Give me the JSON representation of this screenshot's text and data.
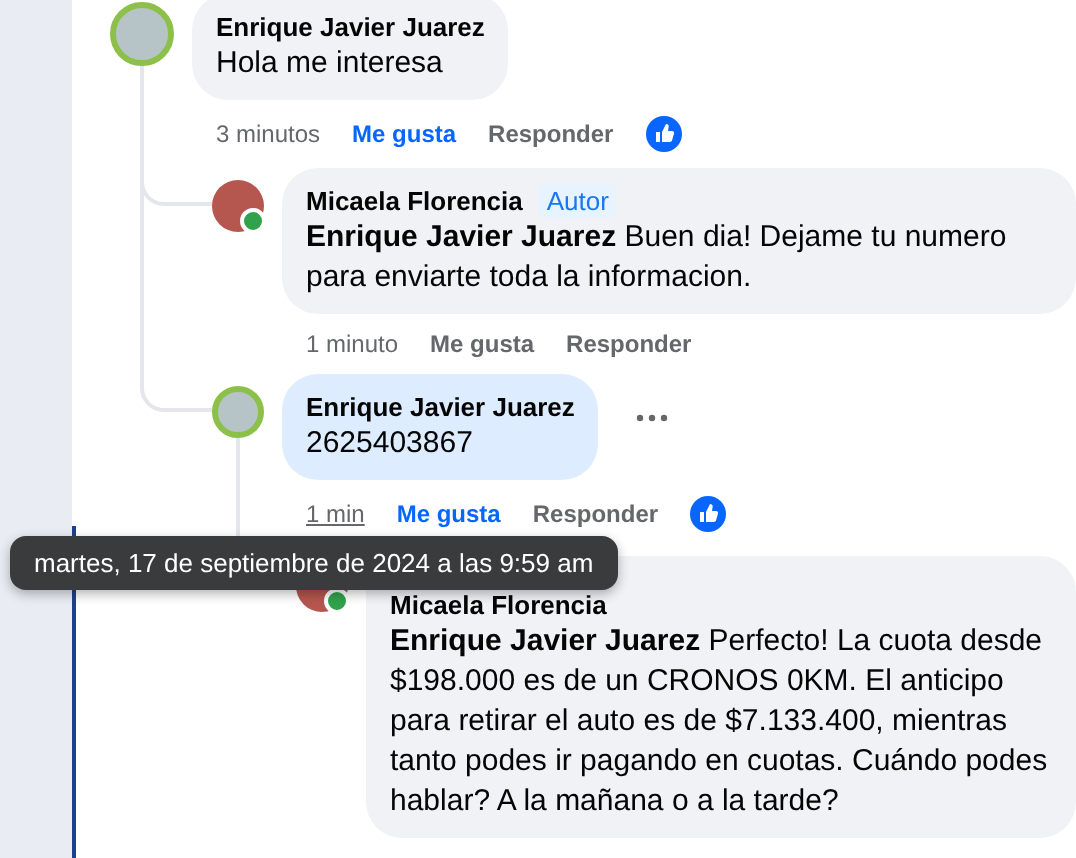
{
  "comments": [
    {
      "author": "Enrique Javier Juarez",
      "text": "Hola me interesa",
      "avatar_ring": true,
      "online": false,
      "highlighted": false,
      "more_menu": false,
      "time": "3 minutos",
      "time_hovered": false,
      "like_label": "Me gusta",
      "liked": true,
      "reply_label": "Responder",
      "reacted": true,
      "children": [
        {
          "author": "Micaela Florencia",
          "badge": "Autor",
          "text": "**Enrique Javier Juarez** Buen dia! Dejame tu numero para enviarte toda la informacion.",
          "avatar_ring": false,
          "online": true,
          "highlighted": false,
          "more_menu": false,
          "time": "1 minuto",
          "time_hovered": false,
          "like_label": "Me gusta",
          "liked": false,
          "reply_label": "Responder",
          "reacted": false
        },
        {
          "author": "Enrique Javier Juarez",
          "text": "2625403867",
          "avatar_ring": true,
          "online": false,
          "highlighted": true,
          "more_menu": true,
          "time": "1 min",
          "time_hovered": true,
          "like_label": "Me gusta",
          "liked": true,
          "reply_label": "Responder",
          "reacted": true,
          "children": [
            {
              "author": "Micaela Florencia",
              "text": "**Enrique Javier Juarez** Perfecto! La cuota desde $198.000 es de un CRONOS 0KM. El anticipo para retirar el auto es de $7.133.400, mientras tanto podes ir pagando en cuotas. Cuándo podes hablar? A la mañana o a la tarde?",
              "avatar_ring": false,
              "online": true,
              "highlighted": false,
              "more_menu": false,
              "reacted": false
            }
          ]
        }
      ]
    }
  ],
  "tooltip": {
    "text": "martes, 17 de septiembre de 2024 a las 9:59 am"
  }
}
